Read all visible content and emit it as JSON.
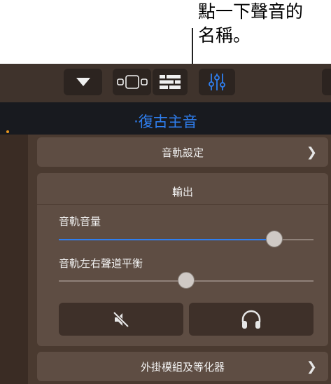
{
  "callout": {
    "text": "點一下聲音的\n名稱。"
  },
  "toolbar": {
    "buttons": [
      {
        "icon": "triangle-down-icon"
      },
      {
        "icon": "view-mode-icon"
      },
      {
        "icon": "mixer-grid-icon"
      },
      {
        "icon": "controls-sliders-icon",
        "active": true
      }
    ],
    "accent": "#2f7ff0"
  },
  "header": {
    "track_name": "‧復古主音"
  },
  "sections": {
    "track_settings": "音軌設定",
    "output": "輸出",
    "plugins": "外掛模組及等化器"
  },
  "output": {
    "volume_label": "音軌音量",
    "volume_value": 0.87,
    "pan_label": "音軌左右聲道平衡",
    "pan_value": 0.5,
    "mute_icon": "speaker-muted-icon",
    "solo_icon": "headphones-icon"
  }
}
